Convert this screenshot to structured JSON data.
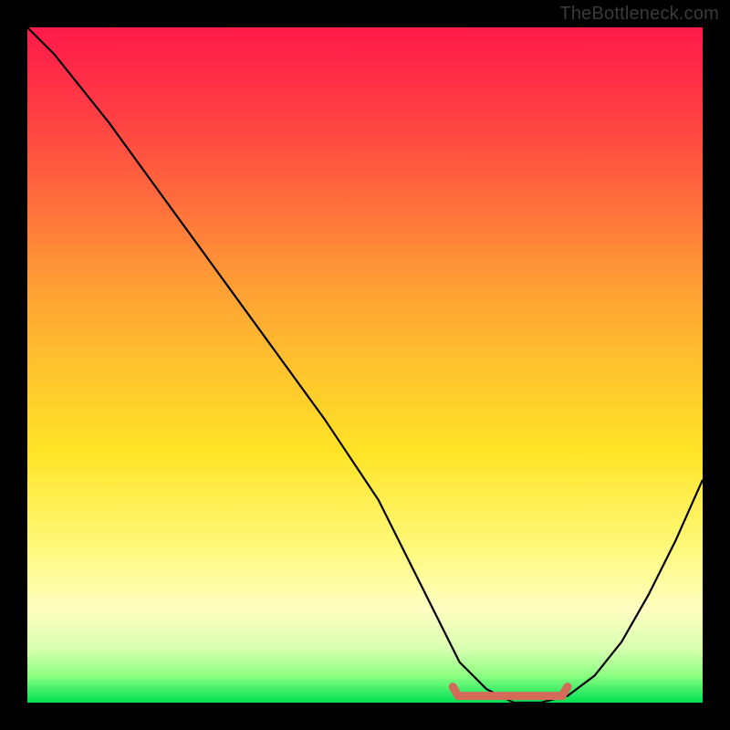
{
  "watermark": "TheBottleneck.com",
  "colors": {
    "frame": "#000000",
    "gradient_top": "#ff1a4a",
    "gradient_bottom": "#00e052",
    "curve": "#000000",
    "low_band": "#d46a5a"
  },
  "chart_data": {
    "type": "line",
    "title": "",
    "xlabel": "",
    "ylabel": "",
    "xlim": [
      0,
      100
    ],
    "ylim": [
      0,
      100
    ],
    "grid": false,
    "series": [
      {
        "name": "bottleneck-curve",
        "x": [
          0,
          4,
          12,
          20,
          28,
          36,
          44,
          52,
          58,
          62,
          64,
          68,
          72,
          76,
          80,
          84,
          88,
          92,
          96,
          100
        ],
        "values": [
          100,
          96,
          86,
          75,
          64,
          53,
          42,
          30,
          18,
          10,
          6,
          2,
          0,
          0,
          1,
          4,
          9,
          16,
          24,
          33
        ]
      }
    ],
    "annotations": [
      {
        "name": "optimal-range-marker",
        "x_start": 63,
        "x_end": 80,
        "y": 1
      }
    ]
  }
}
